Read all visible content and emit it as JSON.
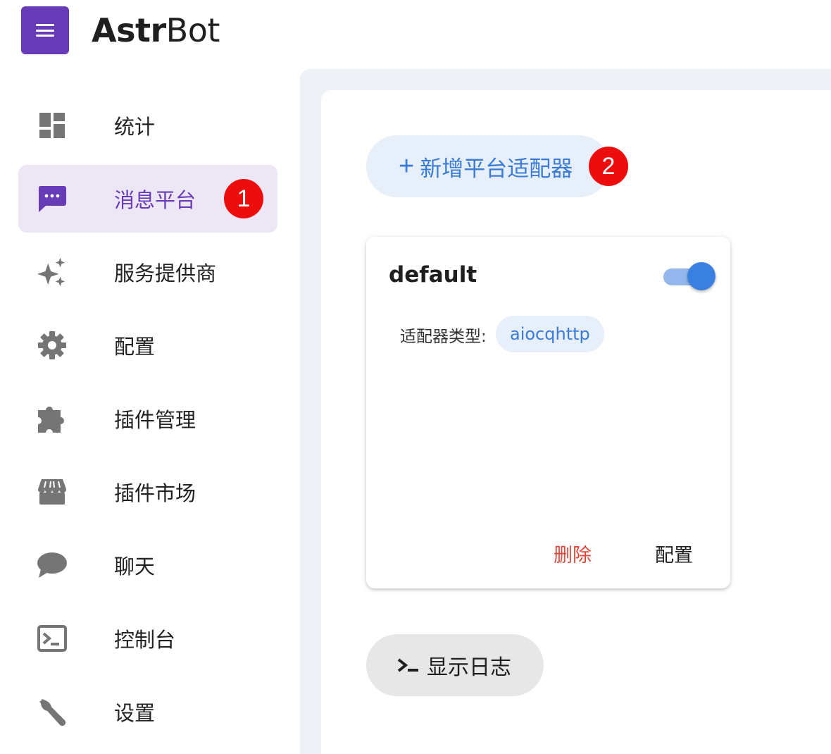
{
  "header": {
    "menu_icon": "menu-icon",
    "logo_bold": "Astr",
    "logo_regular": "Bot"
  },
  "sidebar": {
    "items": [
      {
        "label": "统计",
        "icon": "dashboard-icon"
      },
      {
        "label": "消息平台",
        "icon": "message-icon",
        "active": true
      },
      {
        "label": "服务提供商",
        "icon": "sparkle-icon"
      },
      {
        "label": "配置",
        "icon": "gear-icon"
      },
      {
        "label": "插件管理",
        "icon": "puzzle-icon"
      },
      {
        "label": "插件市场",
        "icon": "store-icon"
      },
      {
        "label": "聊天",
        "icon": "chat-icon"
      },
      {
        "label": "控制台",
        "icon": "console-icon"
      },
      {
        "label": "设置",
        "icon": "wrench-icon"
      }
    ]
  },
  "markers": {
    "one": "1",
    "two": "2"
  },
  "main": {
    "add_button": {
      "plus": "+",
      "label": "新增平台适配器"
    },
    "adapter": {
      "name": "default",
      "enabled": true,
      "type_label": "适配器类型:",
      "type_value": "aiocqhttp",
      "delete_label": "删除",
      "config_label": "配置"
    },
    "log_button": {
      "label": "显示日志"
    }
  },
  "colors": {
    "accent": "#673ab7",
    "active_bg": "#ece6f5",
    "primary_blue": "#3a7bd5",
    "danger": "#e0473a",
    "marker_red": "#ee0d0d"
  }
}
